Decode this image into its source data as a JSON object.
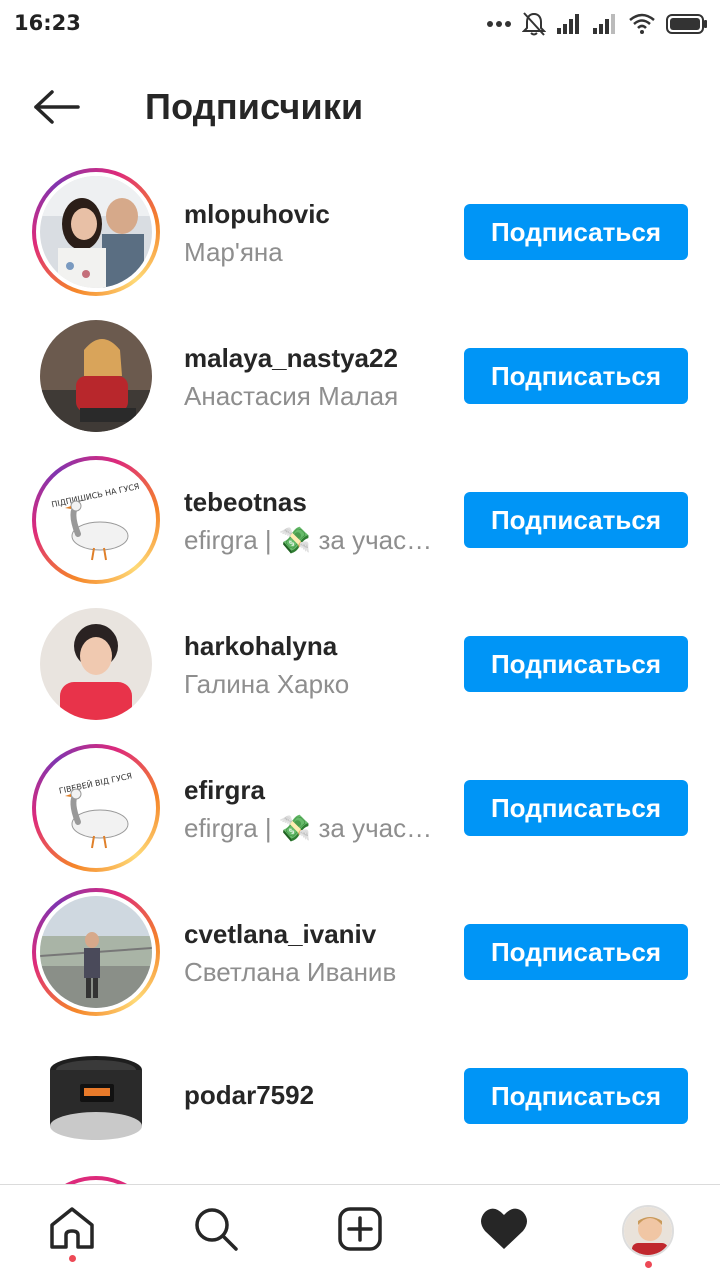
{
  "status_bar": {
    "time": "16:23"
  },
  "header": {
    "title": "Подписчики",
    "back_icon": "arrow-left-icon"
  },
  "follow_label": "Подписаться",
  "followers": [
    {
      "username": "mlopuhovic",
      "full_name": "Мар'яна",
      "story_ring": true
    },
    {
      "username": "malaya_nastya22",
      "full_name": "Анастасия Малая",
      "story_ring": false
    },
    {
      "username": "tebeotnas",
      "full_name": "efirgra | 💸 за участие",
      "story_ring": true,
      "avatar_text": "ПІДПИШИСЬ НА ГУСЯ"
    },
    {
      "username": "harkohalyna",
      "full_name": "Галина Харко",
      "story_ring": false
    },
    {
      "username": "efirgra",
      "full_name": "efirgra | 💸 за участие",
      "story_ring": true,
      "avatar_text": "ГІВЕВЕЙ ВІД ГУСЯ"
    },
    {
      "username": "cvetlana_ivaniv",
      "full_name": "Светлана Иванив",
      "story_ring": true
    },
    {
      "username": "podar7592",
      "full_name": "",
      "story_ring": false
    }
  ],
  "bottom_nav": {
    "items": [
      "home-icon",
      "search-icon",
      "add-post-icon",
      "activity-heart-icon",
      "profile-avatar"
    ]
  },
  "colors": {
    "accent": "#0095f6",
    "notification_dot": "#ed4956",
    "secondary_text": "#8e8e8e"
  }
}
